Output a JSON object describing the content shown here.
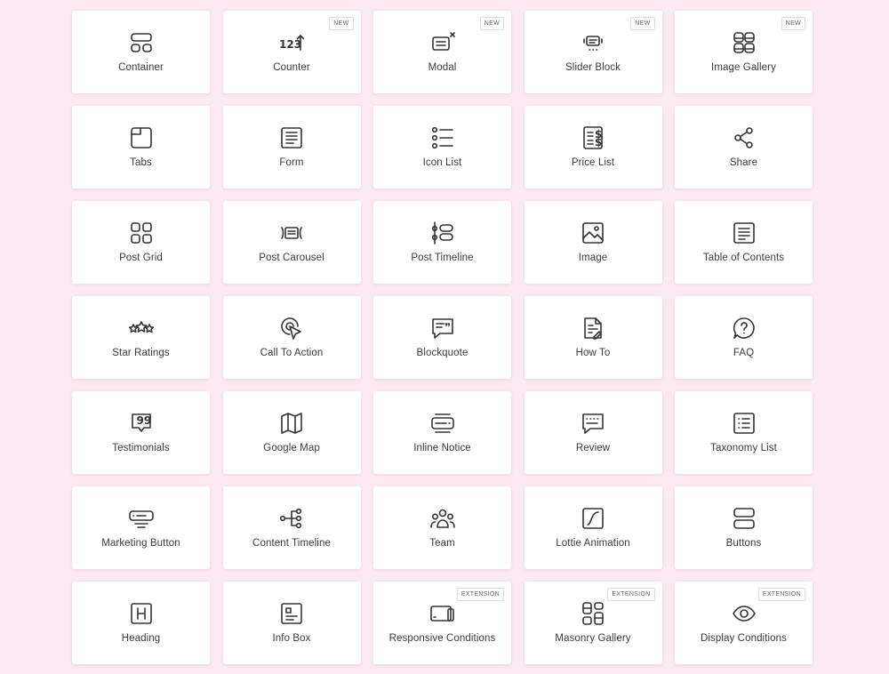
{
  "blocks": [
    {
      "label": "Container",
      "icon": "container-icon",
      "badge": ""
    },
    {
      "label": "Counter",
      "icon": "counter-icon",
      "badge": "NEW"
    },
    {
      "label": "Modal",
      "icon": "modal-icon",
      "badge": "NEW"
    },
    {
      "label": "Slider Block",
      "icon": "slider-icon",
      "badge": "NEW"
    },
    {
      "label": "Image Gallery",
      "icon": "image-gallery-icon",
      "badge": "NEW"
    },
    {
      "label": "Tabs",
      "icon": "tabs-icon",
      "badge": ""
    },
    {
      "label": "Form",
      "icon": "form-icon",
      "badge": ""
    },
    {
      "label": "Icon List",
      "icon": "icon-list-icon",
      "badge": ""
    },
    {
      "label": "Price List",
      "icon": "price-list-icon",
      "badge": ""
    },
    {
      "label": "Share",
      "icon": "share-icon",
      "badge": ""
    },
    {
      "label": "Post Grid",
      "icon": "post-grid-icon",
      "badge": ""
    },
    {
      "label": "Post Carousel",
      "icon": "post-carousel-icon",
      "badge": ""
    },
    {
      "label": "Post Timeline",
      "icon": "post-timeline-icon",
      "badge": ""
    },
    {
      "label": "Image",
      "icon": "image-icon",
      "badge": ""
    },
    {
      "label": "Table of Contents",
      "icon": "table-of-contents-icon",
      "badge": ""
    },
    {
      "label": "Star Ratings",
      "icon": "star-ratings-icon",
      "badge": ""
    },
    {
      "label": "Call To Action",
      "icon": "call-to-action-icon",
      "badge": ""
    },
    {
      "label": "Blockquote",
      "icon": "blockquote-icon",
      "badge": ""
    },
    {
      "label": "How To",
      "icon": "how-to-icon",
      "badge": ""
    },
    {
      "label": "FAQ",
      "icon": "faq-icon",
      "badge": ""
    },
    {
      "label": "Testimonials",
      "icon": "testimonials-icon",
      "badge": ""
    },
    {
      "label": "Google Map",
      "icon": "google-map-icon",
      "badge": ""
    },
    {
      "label": "Inline Notice",
      "icon": "inline-notice-icon",
      "badge": ""
    },
    {
      "label": "Review",
      "icon": "review-icon",
      "badge": ""
    },
    {
      "label": "Taxonomy List",
      "icon": "taxonomy-list-icon",
      "badge": ""
    },
    {
      "label": "Marketing Button",
      "icon": "marketing-button-icon",
      "badge": ""
    },
    {
      "label": "Content Timeline",
      "icon": "content-timeline-icon",
      "badge": ""
    },
    {
      "label": "Team",
      "icon": "team-icon",
      "badge": ""
    },
    {
      "label": "Lottie Animation",
      "icon": "lottie-animation-icon",
      "badge": ""
    },
    {
      "label": "Buttons",
      "icon": "buttons-icon",
      "badge": ""
    },
    {
      "label": "Heading",
      "icon": "heading-icon",
      "badge": ""
    },
    {
      "label": "Info Box",
      "icon": "info-box-icon",
      "badge": ""
    },
    {
      "label": "Responsive Conditions",
      "icon": "responsive-conditions-icon",
      "badge": "EXTENSION"
    },
    {
      "label": "Masonry Gallery",
      "icon": "masonry-gallery-icon",
      "badge": "EXTENSION"
    },
    {
      "label": "Display Conditions",
      "icon": "display-conditions-icon",
      "badge": "EXTENSION"
    }
  ]
}
